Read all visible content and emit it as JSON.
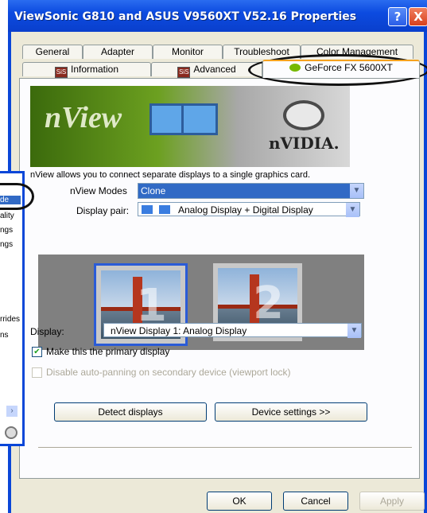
{
  "window": {
    "title": "ViewSonic G810 and ASUS V9560XT V52.16 Properties",
    "help_label": "?",
    "close_label": "X"
  },
  "tabs_row1": [
    "General",
    "Adapter",
    "Monitor",
    "Troubleshoot",
    "Color Management"
  ],
  "tabs_row2": [
    {
      "label": "Information",
      "icon": "sis-icon"
    },
    {
      "label": "Advanced",
      "icon": "sis-icon"
    },
    {
      "label": "GeForce FX 5600XT",
      "icon": "nvidia-icon"
    }
  ],
  "banner": {
    "logo": "nView",
    "brand": "nVIDIA."
  },
  "description": "nView allows you to connect separate displays to a single graphics card.",
  "nview_modes": {
    "label": "nView Modes",
    "value": "Clone"
  },
  "display_pair": {
    "label": "Display pair:",
    "value": "Analog Display + Digital Display"
  },
  "monitors": [
    {
      "number": "1",
      "selected": true
    },
    {
      "number": "2",
      "selected": false
    }
  ],
  "display": {
    "label": "Display:",
    "value": "nView Display 1: Analog Display"
  },
  "primary_checkbox": {
    "label": "Make this the primary display",
    "checked": true
  },
  "autopan_checkbox": {
    "label": "Disable auto-panning on secondary device (viewport lock)",
    "checked": false,
    "disabled": true
  },
  "buttons": {
    "detect": "Detect displays",
    "device": "Device settings >>",
    "ok": "OK",
    "cancel": "Cancel",
    "apply": "Apply"
  },
  "left_fragments": [
    "de",
    "ality",
    "ngs",
    "ngs",
    "rrides",
    "ns"
  ],
  "colors": {
    "title_blue": "#0a46d8",
    "selection": "#316ac5",
    "nvidia_green": "#76b900"
  }
}
